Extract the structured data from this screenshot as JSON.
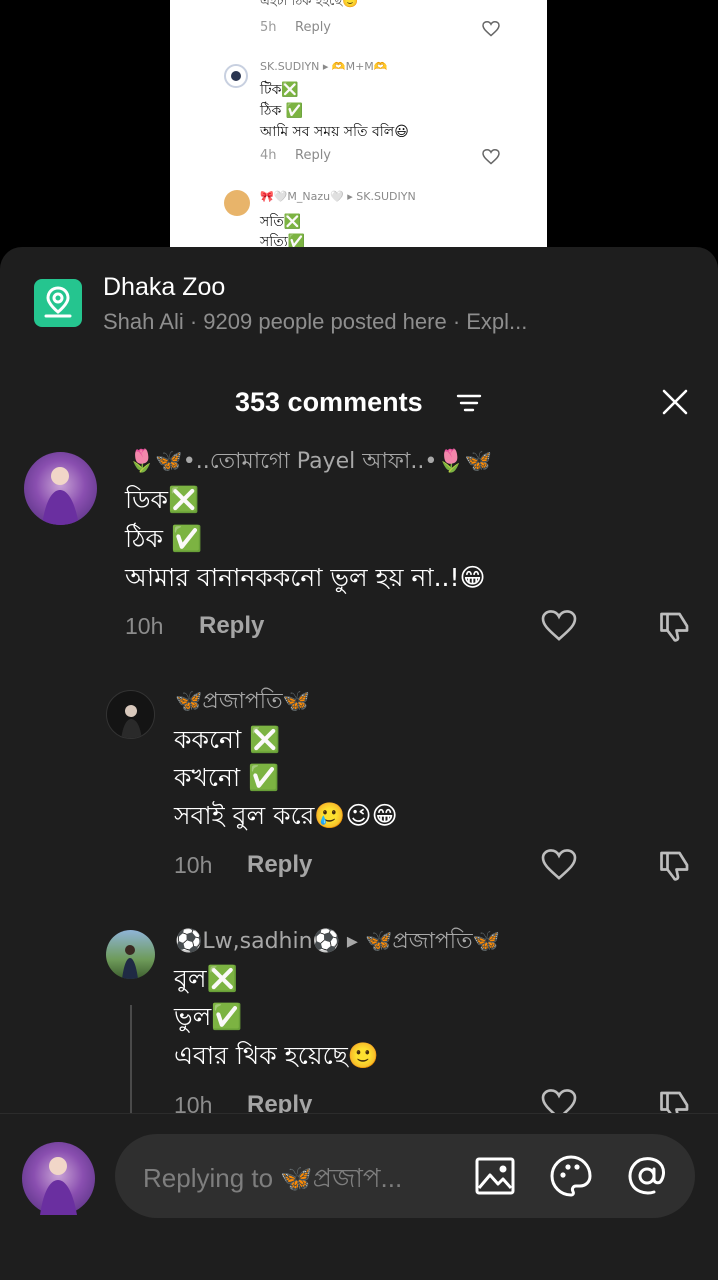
{
  "preview": {
    "top_text": "এইটা ঠিক হইছে🙂",
    "top_time": "5h",
    "top_reply": "Reply",
    "c1_user": "SK.SUDIYN ▸ 🫶M+M🫶",
    "c1_lines": [
      "টিক❎",
      "ঠিক ✅",
      "আমি সব সময় সতি বলি😃"
    ],
    "c1_time": "4h",
    "c1_reply": "Reply",
    "c2_user": "🎀🤍M_Nazu🤍 ▸ SK.SUDIYN",
    "c2_lines": [
      "সতি❎",
      "সত্যি✅"
    ]
  },
  "location": {
    "title": "Dhaka Zoo",
    "subtitle": "Shah Ali · 9209 people posted here · Expl..."
  },
  "header": {
    "count": "353 comments"
  },
  "comments": [
    {
      "user": "🌷🦋•..তোমাগো Payel আফা..•🌷🦋",
      "lines": [
        "ডিক❎",
        "ঠিক ✅",
        "আমার বানানককনো ভুল হয় না..!😁"
      ],
      "time": "10h",
      "reply": "Reply"
    },
    {
      "user": "🦋প্রজাপতি🦋",
      "lines": [
        "ককনো ❎",
        "কখনো ✅",
        "সবাই বুল করে🥲😉😁"
      ],
      "time": "10h",
      "reply": "Reply"
    },
    {
      "user": "⚽Lw,sadhin⚽ ▸ 🦋প্রজাপতি🦋",
      "lines": [
        "বুল❎",
        "ভুল✅",
        "এবার থিক হয়েছে🙂"
      ],
      "time": "10h",
      "reply": "Reply"
    }
  ],
  "input": {
    "placeholder": "Replying to 🦋প্রজাপ..."
  },
  "colors": {
    "sheet": "#1e1e1e",
    "accent": "#25c58f",
    "pill": "#2f2f2f"
  },
  "icons": [
    "location-pin-icon",
    "sort-icon",
    "close-icon",
    "heart-icon",
    "dislike-icon",
    "image-icon",
    "sticker-icon",
    "mention-icon"
  ]
}
